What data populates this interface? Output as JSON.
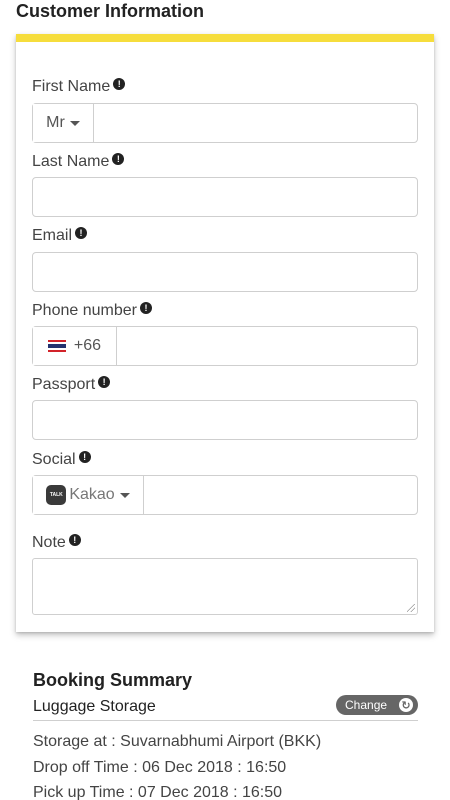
{
  "section_title": "Customer Information",
  "form": {
    "first_name": {
      "label": "First Name",
      "title_value": "Mr",
      "value": ""
    },
    "last_name": {
      "label": "Last Name",
      "value": ""
    },
    "email": {
      "label": "Email",
      "value": ""
    },
    "phone": {
      "label": "Phone number",
      "country_code": "+66",
      "flag": "thailand-flag-icon",
      "value": ""
    },
    "passport": {
      "label": "Passport",
      "value": ""
    },
    "social": {
      "label": "Social",
      "platform": "Kakao",
      "platform_icon_text": "TALK",
      "value": ""
    },
    "note": {
      "label": "Note",
      "value": ""
    },
    "info_icon_glyph": "!"
  },
  "summary": {
    "title": "Booking Summary",
    "service": "Luggage Storage",
    "change_label": "Change",
    "storage_at": "Storage at : Suvarnabhumi Airport (BKK)",
    "drop_off": "Drop off Time : 06 Dec 2018 : 16:50",
    "pick_up": "Pick up Time : 07 Dec 2018 : 16:50"
  },
  "colors": {
    "accent_yellow": "#f6dd3c",
    "button_gray": "#666666"
  }
}
